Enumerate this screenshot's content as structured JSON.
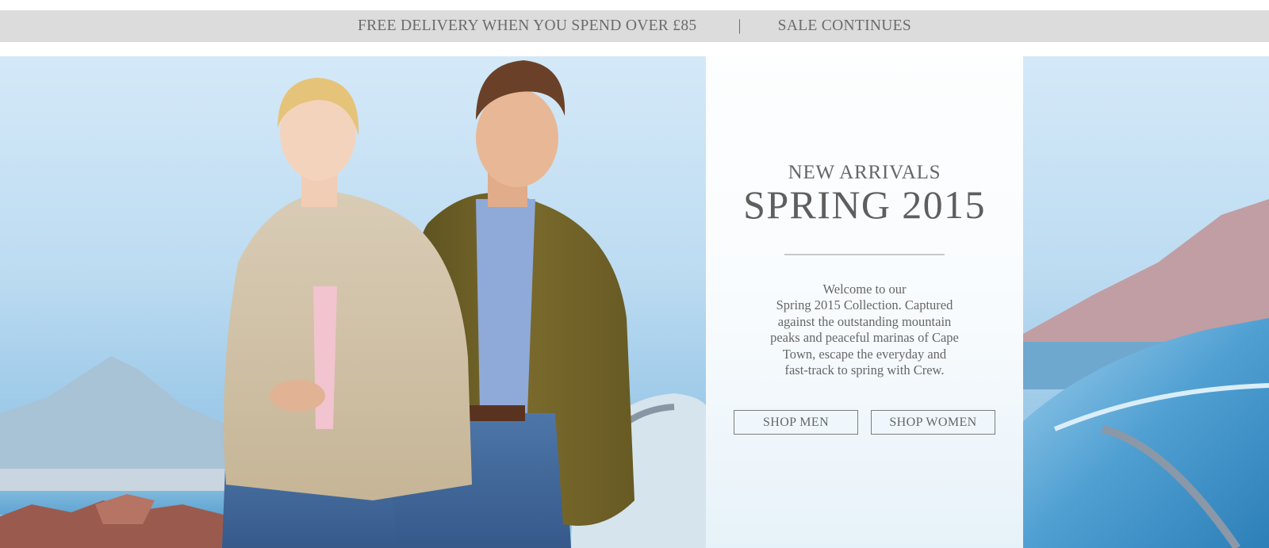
{
  "promo": {
    "delivery_text": "FREE DELIVERY WHEN YOU SPEND OVER £85",
    "separator": "|",
    "sale_text": "SALE CONTINUES"
  },
  "hero": {
    "image": "couple-seaside-lifestyle-photo",
    "eyebrow": "NEW ARRIVALS",
    "headline": "SPRING 2015",
    "intro_lines": [
      "Welcome to our",
      "Spring 2015 Collection. Captured",
      "against the outstanding mountain",
      "peaks and peaceful marinas of Cape",
      "Town, escape the everyday and",
      "fast-track to spring with Crew."
    ],
    "buttons": {
      "men": "SHOP MEN",
      "women": "SHOP WOMEN"
    }
  },
  "colors": {
    "promo_bg": "#dcdcdc",
    "text_gray": "#666666",
    "sky": "#bcdbf1"
  }
}
